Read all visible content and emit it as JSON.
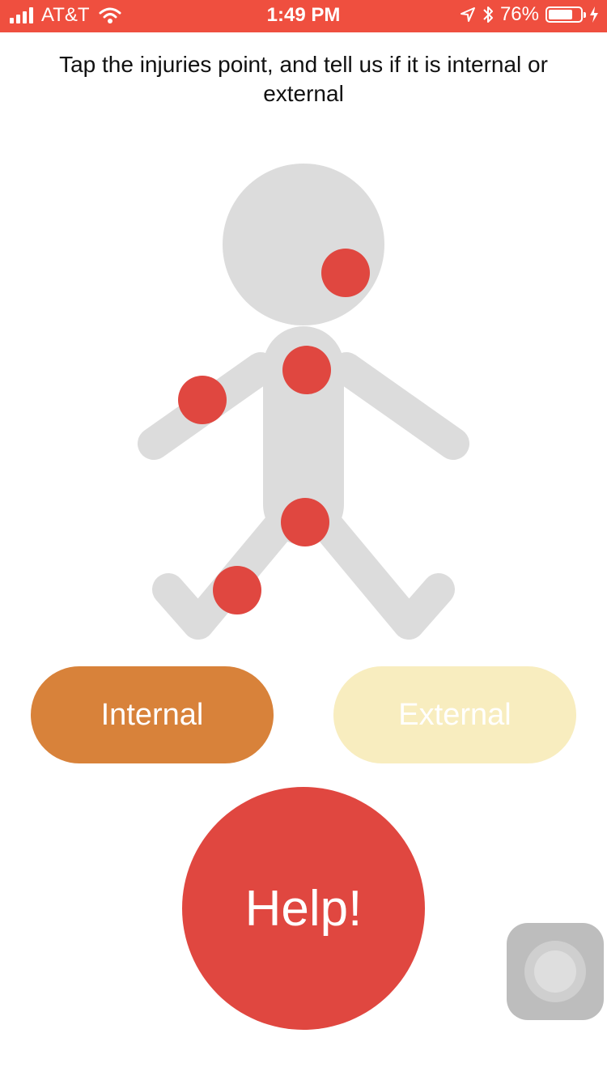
{
  "status_bar": {
    "carrier": "AT&T",
    "time": "1:49 PM",
    "battery_percent": "76%",
    "battery_level": 0.76,
    "icons": [
      "signal-icon",
      "wifi-icon",
      "location-icon",
      "bluetooth-icon",
      "battery-icon",
      "charging-icon"
    ],
    "color": "#ef4f3f"
  },
  "instruction": "Tap the injuries point, and tell us if it is internal or external",
  "figure": {
    "body_color": "#dcdcdc",
    "injury_color": "#e04740",
    "injury_points": [
      "head",
      "chest",
      "left-arm",
      "hip",
      "left-knee"
    ]
  },
  "buttons": {
    "internal_label": "Internal",
    "external_label": "External",
    "help_label": "Help!"
  },
  "colors": {
    "internal": "#d8823a",
    "external": "#f8edbf",
    "help": "#e04740"
  }
}
